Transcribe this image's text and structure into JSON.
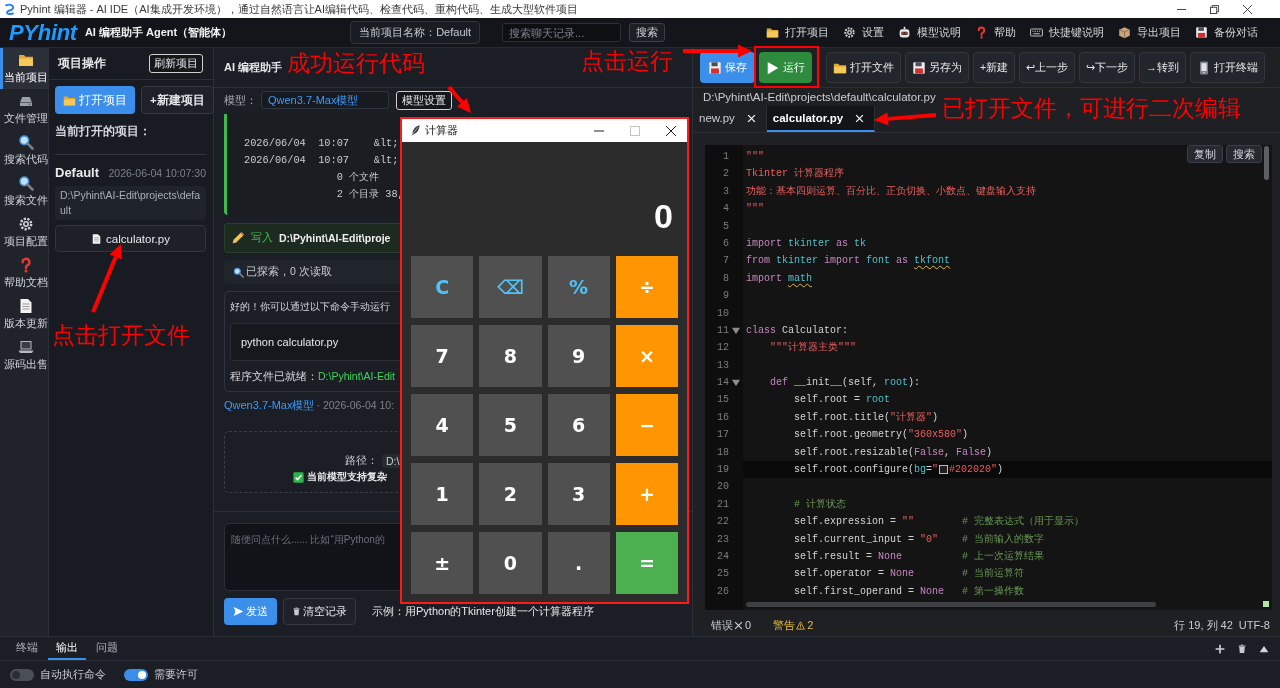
{
  "window": {
    "title": "Pyhint 编辑器 - AI IDE（AI集成开发环境），通过自然语言让AI编辑代码、检查代码、重构代码、生成大型软件项目"
  },
  "header": {
    "logo": "PYhint",
    "subtitle": "AI 编程助手 Agent（智能体）",
    "project_name": "当前项目名称：Default",
    "search": {
      "placeholder": "搜索聊天记录...",
      "button": "搜索"
    },
    "menu": [
      "打开项目",
      "设置",
      "模型说明",
      "帮助",
      "快捷键说明",
      "导出项目",
      "备份对话"
    ]
  },
  "activity_bar": [
    {
      "label": "当前项目",
      "selected": true
    },
    {
      "label": "文件管理",
      "selected": false
    },
    {
      "label": "搜索代码",
      "selected": false
    },
    {
      "label": "搜索文件",
      "selected": false
    },
    {
      "label": "项目配置",
      "selected": false
    },
    {
      "label": "帮助文档",
      "selected": false
    },
    {
      "label": "版本更新",
      "selected": false
    },
    {
      "label": "源码出售",
      "selected": false
    }
  ],
  "project_panel": {
    "title": "项目操作",
    "refresh_button": "刷新项目",
    "buttons": [
      {
        "label": "打开项目",
        "kind": "primary"
      },
      {
        "label": "+新建项目",
        "kind": "secondary"
      }
    ],
    "section_label": "当前打开的项目：",
    "project": {
      "name": "Default",
      "time": "2026-06-04 10:07:30",
      "path": "D:\\Pyhint\\AI-Edit\\projects\\default",
      "files": [
        "calculator.py"
      ]
    }
  },
  "chat": {
    "title": "AI 编程助手",
    "model_label": "模型：",
    "model": "Qwen3.7-Max模型",
    "model_button": "模型设置",
    "messages": [
      {
        "kind": "output",
        "lines": [
          "2026/06/04  10:07    &lt;",
          "2026/06/04  10:07    &lt;",
          "               0 个文件",
          "               2 个目录 38,"
        ]
      },
      {
        "kind": "write",
        "action": "写入",
        "path": "D:\\Pyhint\\AI-Edit\\proje"
      },
      {
        "kind": "explore",
        "text": "已探索，0 次读取"
      },
      {
        "kind": "reply",
        "text": "好的！你可以通过以下命令手动运行",
        "code": "python calculator.py",
        "footer_label": "程序文件已就绪：",
        "footer_path": "D:\\Pyhint\\AI-Edit"
      },
      {
        "kind": "meta",
        "model": "Qwen3.7-Max模型",
        "time": "· 2026-06-04 10:"
      },
      {
        "kind": "info",
        "path_label": "路径：",
        "path": "D:\\",
        "note": "当前模型支持复杂"
      }
    ],
    "input": {
      "placeholder": "随便问点什么...... 比如“用Python的"
    },
    "send_button": "发送",
    "clear_button": "清空记录",
    "example": "示例：用Python的Tkinter创建一个计算器程序"
  },
  "calculator": {
    "title": "计算器",
    "maximize_disabled": true,
    "display": "0",
    "keys": [
      {
        "label": "C",
        "kind": "func"
      },
      {
        "label": "⌫",
        "kind": "func"
      },
      {
        "label": "%",
        "kind": "func"
      },
      {
        "label": "÷",
        "kind": "op"
      },
      {
        "label": "7",
        "kind": "digit"
      },
      {
        "label": "8",
        "kind": "digit"
      },
      {
        "label": "9",
        "kind": "digit"
      },
      {
        "label": "×",
        "kind": "op"
      },
      {
        "label": "4",
        "kind": "digit"
      },
      {
        "label": "5",
        "kind": "digit"
      },
      {
        "label": "6",
        "kind": "digit"
      },
      {
        "label": "−",
        "kind": "op"
      },
      {
        "label": "1",
        "kind": "digit"
      },
      {
        "label": "2",
        "kind": "digit"
      },
      {
        "label": "3",
        "kind": "digit"
      },
      {
        "label": "+",
        "kind": "op"
      },
      {
        "label": "±",
        "kind": "digit"
      },
      {
        "label": "0",
        "kind": "digit"
      },
      {
        "label": ".",
        "kind": "digit"
      },
      {
        "label": "=",
        "kind": "equals"
      }
    ]
  },
  "editor": {
    "toolbar": [
      {
        "label": "保存",
        "kind": "primary"
      },
      {
        "label": "运行",
        "kind": "run"
      },
      {
        "label": "打开文件",
        "kind": "plain"
      },
      {
        "label": "另存为",
        "kind": "plain"
      },
      {
        "label": "+新建",
        "kind": "plain"
      },
      {
        "label": "↩上一步",
        "kind": "plain"
      },
      {
        "label": "↪下一步",
        "kind": "plain"
      },
      {
        "label": "→转到",
        "kind": "plain"
      },
      {
        "label": "打开终端",
        "kind": "plain"
      }
    ],
    "path": "D:\\Pyhint\\AI-Edit\\projects\\default\\calculator.py",
    "tabs": [
      {
        "label": "new.py",
        "selected": false
      },
      {
        "label": "calculator.py",
        "selected": true
      }
    ],
    "actions": [
      "复制",
      "搜索"
    ],
    "lines": [
      {
        "number": "1",
        "foldable": false,
        "current": false,
        "tokens": [
          {
            "kind": "str",
            "text": "\"\"\""
          }
        ]
      },
      {
        "number": "2",
        "foldable": false,
        "current": false,
        "tokens": [
          {
            "kind": "str",
            "text": "Tkinter 计算器程序"
          }
        ]
      },
      {
        "number": "3",
        "foldable": false,
        "current": false,
        "tokens": [
          {
            "kind": "str",
            "text": "功能：基本四则运算、百分比、正负切换、小数点、键盘输入支持"
          }
        ]
      },
      {
        "number": "4",
        "foldable": false,
        "current": false,
        "tokens": [
          {
            "kind": "str",
            "text": "\"\"\""
          }
        ]
      },
      {
        "number": "5",
        "foldable": false,
        "current": false
      },
      {
        "number": "6",
        "foldable": false,
        "current": false,
        "tokens": [
          {
            "kind": "kw",
            "text": "import"
          },
          {
            "kind": "name",
            "text": " tkinter "
          },
          {
            "kind": "kw",
            "text": "as"
          },
          {
            "kind": "name",
            "text": " tk"
          }
        ]
      },
      {
        "number": "7",
        "foldable": false,
        "current": false,
        "tokens": [
          {
            "kind": "kw",
            "text": "from"
          },
          {
            "kind": "name",
            "text": " tkinter "
          },
          {
            "kind": "kw",
            "text": "import"
          },
          {
            "kind": "name",
            "text": " font "
          },
          {
            "kind": "kw",
            "text": "as "
          },
          {
            "kind": "warn",
            "text": "tkfont"
          }
        ]
      },
      {
        "number": "8",
        "foldable": false,
        "current": false,
        "tokens": [
          {
            "kind": "kw",
            "text": "import "
          },
          {
            "kind": "warn",
            "text": "math"
          }
        ]
      },
      {
        "number": "9",
        "foldable": false,
        "current": false
      },
      {
        "number": "10",
        "foldable": false,
        "current": false
      },
      {
        "number": "11",
        "foldable": true,
        "current": false,
        "tokens": [
          {
            "kind": "kw",
            "text": "class"
          },
          {
            "kind": "plain",
            "text": " Calculator:"
          }
        ]
      },
      {
        "number": "12",
        "foldable": false,
        "current": false,
        "tokens": [
          {
            "kind": "str",
            "text": "    \"\"\"计算器主类\"\"\""
          }
        ]
      },
      {
        "number": "13",
        "foldable": false,
        "current": false
      },
      {
        "number": "14",
        "foldable": true,
        "current": false,
        "tokens": [
          {
            "kind": "kw",
            "text": "    def"
          },
          {
            "kind": "plain",
            "text": " __init__(self, "
          },
          {
            "kind": "name",
            "text": "root"
          },
          {
            "kind": "plain",
            "text": "):"
          }
        ]
      },
      {
        "number": "15",
        "foldable": false,
        "current": false,
        "tokens": [
          {
            "kind": "plain",
            "text": "        self.root = "
          },
          {
            "kind": "name",
            "text": "root"
          }
        ]
      },
      {
        "number": "16",
        "foldable": false,
        "current": false,
        "tokens": [
          {
            "kind": "plain",
            "text": "        self.root.title("
          },
          {
            "kind": "str",
            "text": "\"计算器\""
          },
          {
            "kind": "plain",
            "text": ")"
          }
        ]
      },
      {
        "number": "17",
        "foldable": false,
        "current": false,
        "tokens": [
          {
            "kind": "plain",
            "text": "        self.root.geometry("
          },
          {
            "kind": "str",
            "text": "\"360x580\""
          },
          {
            "kind": "plain",
            "text": ")"
          }
        ]
      },
      {
        "number": "18",
        "foldable": false,
        "current": false,
        "tokens": [
          {
            "kind": "plain",
            "text": "        self.root.resizable("
          },
          {
            "kind": "kw",
            "text": "False"
          },
          {
            "kind": "plain",
            "text": ", "
          },
          {
            "kind": "kw",
            "text": "False"
          },
          {
            "kind": "plain",
            "text": ")"
          }
        ]
      },
      {
        "number": "19",
        "foldable": false,
        "current": true,
        "tokens": [
          {
            "kind": "plain",
            "text": "        self.root.configure("
          },
          {
            "kind": "name",
            "text": "bg"
          },
          {
            "kind": "plain",
            "text": "="
          },
          {
            "kind": "str",
            "text": "\""
          },
          {
            "kind": "swatch"
          },
          {
            "kind": "str",
            "text": "#202020\""
          },
          {
            "kind": "plain",
            "text": ")"
          }
        ]
      },
      {
        "number": "20",
        "foldable": false,
        "current": false
      },
      {
        "number": "21",
        "foldable": false,
        "current": false,
        "tokens": [
          {
            "kind": "comment",
            "text": "        # 计算状态"
          }
        ]
      },
      {
        "number": "22",
        "foldable": false,
        "current": false,
        "tokens": [
          {
            "kind": "plain",
            "text": "        self.expression = "
          },
          {
            "kind": "str",
            "text": "\"\""
          },
          {
            "kind": "comment",
            "text": "        # 完整表达式（用于显示）"
          }
        ]
      },
      {
        "number": "23",
        "foldable": false,
        "current": false,
        "tokens": [
          {
            "kind": "plain",
            "text": "        self.current_input = "
          },
          {
            "kind": "str",
            "text": "\"0\""
          },
          {
            "kind": "comment",
            "text": "    # 当前输入的数字"
          }
        ]
      },
      {
        "number": "24",
        "foldable": false,
        "current": false,
        "tokens": [
          {
            "kind": "plain",
            "text": "        self.result = "
          },
          {
            "kind": "kw",
            "text": "None"
          },
          {
            "kind": "comment",
            "text": "          # 上一次运算结果"
          }
        ]
      },
      {
        "number": "25",
        "foldable": false,
        "current": false,
        "tokens": [
          {
            "kind": "plain",
            "text": "        self.operator = "
          },
          {
            "kind": "kw",
            "text": "None"
          },
          {
            "kind": "comment",
            "text": "        # 当前运算符"
          }
        ]
      },
      {
        "number": "26",
        "foldable": false,
        "current": false,
        "tokens": [
          {
            "kind": "plain",
            "text": "        self.first_operand = "
          },
          {
            "kind": "kw",
            "text": "None"
          },
          {
            "kind": "comment",
            "text": "   # 第一操作数"
          }
        ]
      }
    ],
    "status": {
      "errors_label": "错误",
      "errors": "0",
      "warnings_label": "警告",
      "warnings": "2",
      "position": "行 19, 列 42",
      "encoding": "UTF-8"
    }
  },
  "bottom_panel": {
    "tabs": [
      {
        "label": "终端",
        "selected": false
      },
      {
        "label": "输出",
        "selected": true
      },
      {
        "label": "问题",
        "selected": false
      }
    ],
    "toggles": [
      {
        "label": "自动执行命令",
        "on": false
      },
      {
        "label": "需要许可",
        "on": true
      }
    ]
  },
  "annotations": [
    {
      "text": "成功运行代码"
    },
    {
      "text": "点击运行"
    },
    {
      "text": "已打开文件，可进行二次编辑"
    },
    {
      "text": "点击打开文件"
    }
  ]
}
